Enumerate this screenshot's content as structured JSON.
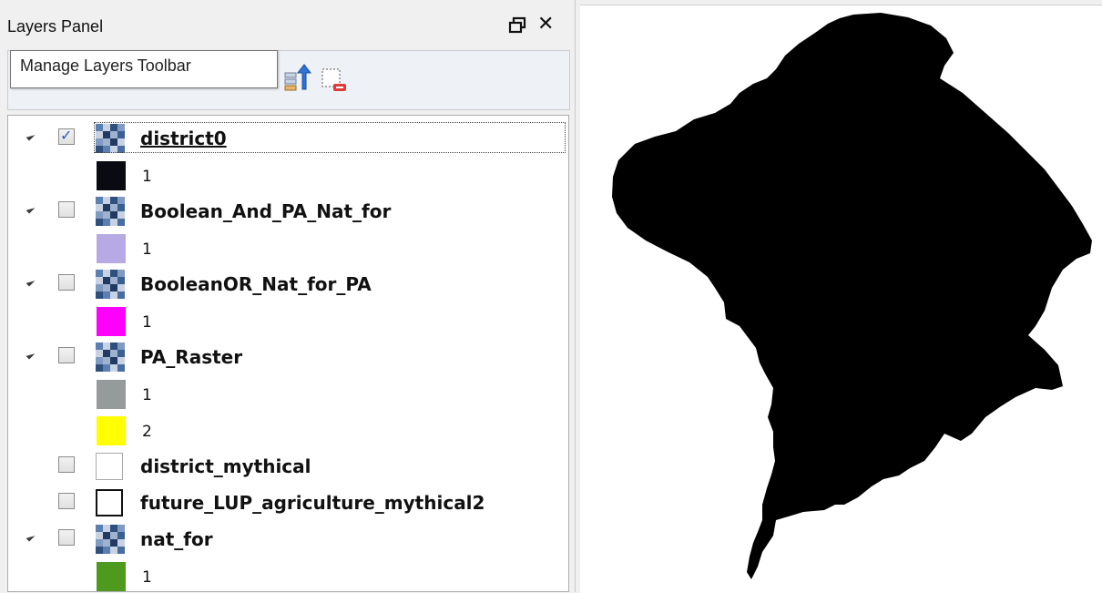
{
  "panel": {
    "title": "Layers Panel",
    "float_icon": "float-window-icon",
    "close_label": "✕"
  },
  "toolbar": {
    "tooltip": "Manage Layers Toolbar",
    "icons": [
      "move-layer-up-icon",
      "remove-layer-icon"
    ]
  },
  "layers": [
    {
      "name": "district0",
      "checked": true,
      "selected": true,
      "icon": "raster-icon",
      "expanded": true,
      "legend": [
        {
          "color": "#0a0a12",
          "value": "1"
        }
      ]
    },
    {
      "name": "Boolean_And_PA_Nat_for",
      "checked": false,
      "icon": "raster-icon",
      "expanded": true,
      "legend": [
        {
          "color": "#b7a9e3",
          "value": "1"
        }
      ]
    },
    {
      "name": "BooleanOR_Nat_for_PA",
      "checked": false,
      "icon": "raster-icon",
      "expanded": true,
      "legend": [
        {
          "color": "#ff00ff",
          "value": "1"
        }
      ]
    },
    {
      "name": "PA_Raster",
      "checked": false,
      "icon": "raster-icon",
      "expanded": true,
      "legend": [
        {
          "color": "#959b9b",
          "value": "1"
        },
        {
          "color": "#ffff00",
          "value": "2"
        }
      ]
    },
    {
      "name": "district_mythical",
      "checked": false,
      "icon": "polygon-vector-icon",
      "expanded": false,
      "legend": []
    },
    {
      "name": "future_LUP_agriculture_mythical2",
      "checked": false,
      "icon": "polygon-vector-icon",
      "expanded": false,
      "legend": []
    },
    {
      "name": "nat_for",
      "checked": false,
      "icon": "raster-icon",
      "expanded": true,
      "legend": [
        {
          "color": "#4e9a1e",
          "value": "1"
        }
      ]
    }
  ],
  "map": {
    "fill_color": "#000000",
    "background": "#ffffff"
  }
}
